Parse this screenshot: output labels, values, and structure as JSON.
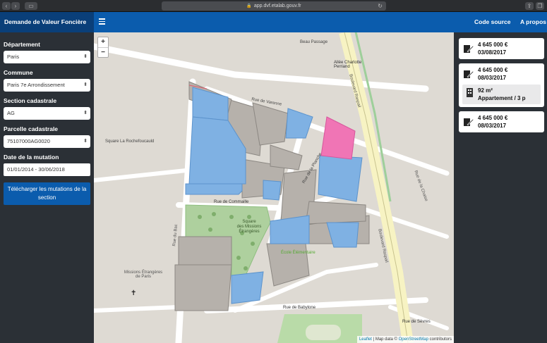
{
  "browser": {
    "url": "app.dvf.etalab.gouv.fr"
  },
  "header": {
    "brand": "Demande de Valeur Foncière",
    "nav_source": "Code source",
    "nav_about": "A propos"
  },
  "sidebar": {
    "departement_label": "Département",
    "departement_value": "Paris",
    "commune_label": "Commune",
    "commune_value": "Paris 7e Arrondissement",
    "section_label": "Section cadastrale",
    "section_value": "AG",
    "parcelle_label": "Parcelle cadastrale",
    "parcelle_value": "75107000AG0020",
    "date_label": "Date de la mutation",
    "date_value": "01/01/2014 - 30/06/2018",
    "download_label": "Télécharger les mutations de la section"
  },
  "map": {
    "streets": {
      "varenne": "Rue de Varenne",
      "beau_passage": "Beau Passage",
      "allee": "Allée Charlotte Perriand",
      "rochefoucauld": "Square La Rochefoucauld",
      "planche": "Rue de la Planche",
      "commaille": "Rue de Commaille",
      "square1": "Square",
      "square2": "des Missions",
      "square3": "Étrangères",
      "babylone": "Rue de Babylone",
      "raspail1": "Boulevard Raspail",
      "raspail2": "Boulevard Raspail",
      "chaise": "Rue de la Chaise",
      "bac": "Rue du Bac",
      "sevres": "Rue de Sèvres",
      "missions": "Missions Étrangères de Paris",
      "ecole": "École Élémentaire"
    },
    "zoom_in": "+",
    "zoom_out": "−",
    "attribution_leaflet": "Leaflet",
    "attribution_text": " | Map data © ",
    "attribution_osm": "OpenStreetMap",
    "attribution_end": " contributors",
    "colors": {
      "parcel_blue": "#7fb1e3",
      "parcel_pink": "#f075b5",
      "parcel_gray": "#b6b1ab",
      "park_green": "#aed09e"
    }
  },
  "panel": {
    "mutations": [
      {
        "price": "4 645 000 €",
        "date": "03/08/2017",
        "icon": "contract-sign-icon"
      },
      {
        "price": "4 645 000 €",
        "date": "08/03/2017",
        "icon": "contract-sign-icon",
        "detail_area": "92 m²",
        "detail_type": "Appartement / 3 p",
        "detail_icon": "building-icon"
      },
      {
        "price": "4 645 000 €",
        "date": "08/03/2017",
        "icon": "contract-sign-icon"
      }
    ]
  }
}
